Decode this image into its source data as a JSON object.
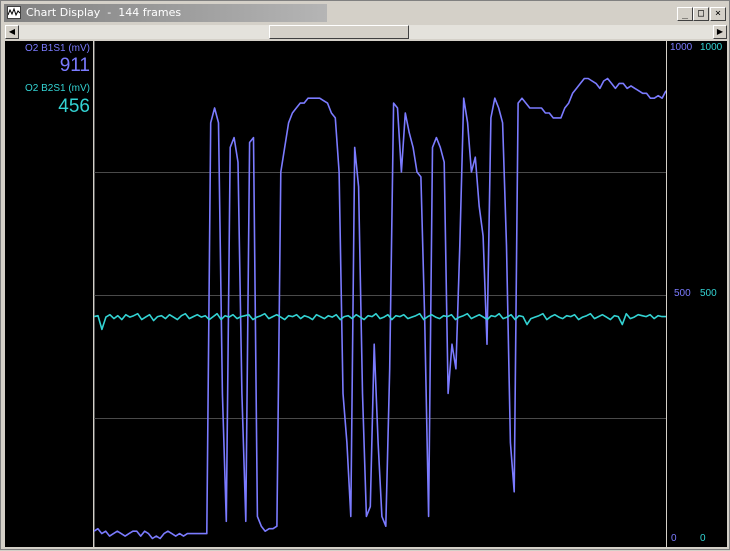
{
  "window": {
    "title": "Chart Display  -  144 frames",
    "minimize_glyph": "_",
    "maximize_glyph": "□",
    "close_glyph": "×",
    "scroll_left_glyph": "◀",
    "scroll_right_glyph": "▶"
  },
  "colors": {
    "series1": "#7b7bff",
    "series2": "#33d3d3",
    "grid": "#4a4a4a",
    "background": "#000000"
  },
  "chart_data": {
    "type": "line",
    "grid": true,
    "ylim": [
      0,
      1000
    ],
    "y_ticks": [
      0,
      500,
      1000
    ],
    "series": [
      {
        "name": "O2 B1S1 (mV)",
        "current": "911",
        "axis_ticks": [
          "1000",
          "500",
          "0"
        ],
        "values": [
          20,
          25,
          15,
          20,
          10,
          15,
          20,
          15,
          10,
          15,
          20,
          20,
          10,
          20,
          15,
          5,
          10,
          5,
          15,
          20,
          15,
          10,
          15,
          10,
          15,
          15,
          15,
          15,
          15,
          15,
          850,
          880,
          850,
          300,
          40,
          800,
          820,
          770,
          300,
          40,
          810,
          820,
          50,
          30,
          20,
          25,
          25,
          30,
          750,
          800,
          850,
          870,
          880,
          890,
          890,
          900,
          900,
          900,
          900,
          895,
          890,
          870,
          860,
          750,
          300,
          200,
          50,
          800,
          720,
          300,
          50,
          70,
          400,
          200,
          50,
          30,
          350,
          890,
          880,
          750,
          870,
          830,
          800,
          750,
          740,
          450,
          50,
          800,
          820,
          800,
          770,
          300,
          400,
          350,
          600,
          900,
          850,
          750,
          780,
          680,
          620,
          400,
          860,
          900,
          880,
          850,
          600,
          200,
          100,
          890,
          900,
          890,
          880,
          880,
          880,
          880,
          870,
          870,
          860,
          860,
          860,
          880,
          890,
          910,
          920,
          930,
          940,
          940,
          935,
          930,
          920,
          935,
          940,
          930,
          920,
          930,
          930,
          920,
          925,
          920,
          915,
          910,
          910,
          900,
          900,
          905,
          900,
          915
        ]
      },
      {
        "name": "O2 B2S1 (mV)",
        "current": "456",
        "axis_ticks": [
          "1000",
          "500",
          "0"
        ],
        "values": [
          456,
          458,
          430,
          455,
          460,
          452,
          458,
          450,
          460,
          455,
          458,
          462,
          450,
          455,
          460,
          448,
          456,
          458,
          452,
          460,
          455,
          450,
          458,
          462,
          452,
          456,
          460,
          455,
          458,
          450,
          456,
          462,
          450,
          458,
          455,
          460,
          452,
          456,
          458,
          460,
          450,
          455,
          458,
          462,
          452,
          456,
          460,
          455,
          450,
          458,
          456,
          460,
          452,
          458,
          455,
          450,
          460,
          456,
          452,
          458,
          455,
          460,
          450,
          456,
          458,
          452,
          460,
          455,
          450,
          458,
          456,
          462,
          452,
          455,
          460,
          450,
          458,
          456,
          460,
          452,
          455,
          458,
          462,
          450,
          456,
          460,
          455,
          452,
          458,
          456,
          460,
          450,
          455,
          458,
          462,
          452,
          456,
          460,
          455,
          450,
          458,
          456,
          462,
          452,
          455,
          460,
          450,
          458,
          456,
          440,
          452,
          455,
          458,
          462,
          450,
          456,
          460,
          455,
          452,
          458,
          456,
          460,
          450,
          455,
          458,
          462,
          452,
          456,
          460,
          455,
          450,
          458,
          456,
          440,
          462,
          452,
          455,
          460,
          458,
          456,
          460,
          452,
          458,
          456,
          456
        ]
      }
    ]
  }
}
